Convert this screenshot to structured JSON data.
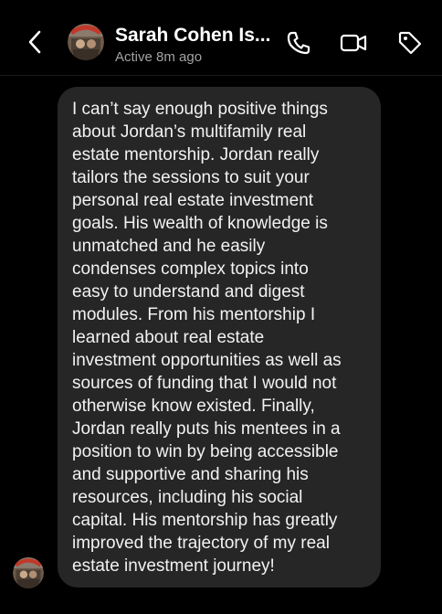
{
  "header": {
    "contact_name": "Sarah Cohen Is...",
    "status": "Active 8m ago",
    "icons": {
      "back": "chevron-left-icon",
      "call": "phone-icon",
      "video": "video-camera-icon",
      "tag": "tag-icon"
    }
  },
  "message": {
    "text": "I can’t say enough positive things\nabout Jordan’s multifamily real\nestate mentorship. Jordan really\ntailors the sessions to suit your\npersonal real estate investment\ngoals. His wealth of knowledge is\nunmatched and he easily\ncondenses complex topics into\neasy to understand and digest\nmodules. From his mentorship I\nlearned about real estate\ninvestment opportunities as well as\nsources of funding that I would not\notherwise know existed. Finally,\nJordan really puts his mentees in a\nposition to win by being accessible\nand supportive and sharing his\nresources, including his social\ncapital. His mentorship has greatly\nimproved the trajectory of my real\nestate investment journey!"
  },
  "colors": {
    "background": "#000000",
    "bubble": "#262626",
    "text": "#f2f2f2",
    "status": "#a3a3a3"
  }
}
